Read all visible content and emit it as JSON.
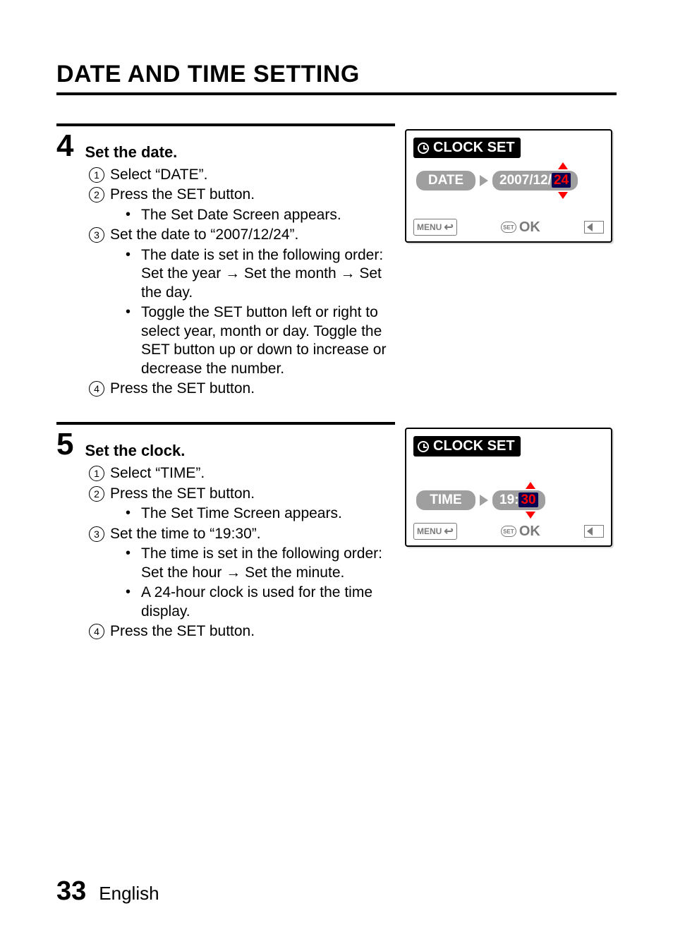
{
  "title": "DATE AND TIME SETTING",
  "steps": [
    {
      "num": "4",
      "title": "Set the date.",
      "subs": [
        {
          "n": "1",
          "text": "Select “DATE”.",
          "bullets": []
        },
        {
          "n": "2",
          "text": "Press the SET button.",
          "bullets": [
            "The Set Date Screen appears."
          ]
        },
        {
          "n": "3",
          "text": "Set the date to “2007/12/24”.",
          "bullets": [
            "The date is set in the following order: Set the year → Set the month → Set the day.",
            "Toggle the SET button left or right to select year, month or day. Toggle the SET button up or down to increase or decrease the number."
          ]
        },
        {
          "n": "4",
          "text": "Press the SET button.",
          "bullets": []
        }
      ],
      "screen": {
        "header": "CLOCK SET",
        "label": "DATE",
        "value_pre": "2007/12/",
        "value_hl": "24",
        "menu": "MENU",
        "set": "SET",
        "ok": "OK"
      }
    },
    {
      "num": "5",
      "title": "Set the clock.",
      "subs": [
        {
          "n": "1",
          "text": "Select “TIME”.",
          "bullets": []
        },
        {
          "n": "2",
          "text": "Press the SET button.",
          "bullets": [
            "The Set Time Screen appears."
          ]
        },
        {
          "n": "3",
          "text": "Set the time to “19:30”.",
          "bullets": [
            "The time is set in the following order: Set the hour → Set the minute.",
            "A 24-hour clock is used for the time display."
          ]
        },
        {
          "n": "4",
          "text": "Press the SET button.",
          "bullets": []
        }
      ],
      "screen": {
        "header": "CLOCK SET",
        "label": "TIME",
        "value_pre": "19:",
        "value_hl": "30",
        "menu": "MENU",
        "set": "SET",
        "ok": "OK"
      }
    }
  ],
  "footer": {
    "page": "33",
    "lang": "English"
  }
}
